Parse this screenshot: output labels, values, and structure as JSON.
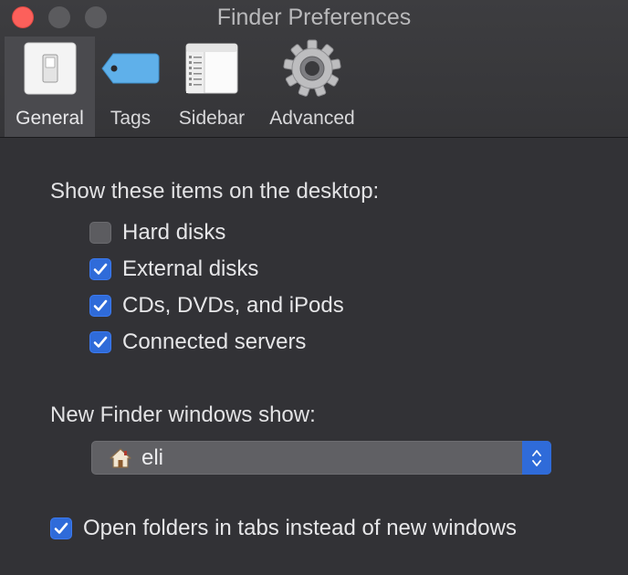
{
  "window": {
    "title": "Finder Preferences"
  },
  "toolbar": {
    "tabs": [
      {
        "label": "General",
        "icon": "switch-icon",
        "active": true
      },
      {
        "label": "Tags",
        "icon": "tag-icon",
        "active": false
      },
      {
        "label": "Sidebar",
        "icon": "sidebar-window-icon",
        "active": false
      },
      {
        "label": "Advanced",
        "icon": "gear-icon",
        "active": false
      }
    ]
  },
  "desktop_section": {
    "heading": "Show these items on the desktop:",
    "items": [
      {
        "label": "Hard disks",
        "checked": false
      },
      {
        "label": "External disks",
        "checked": true
      },
      {
        "label": "CDs, DVDs, and iPods",
        "checked": true
      },
      {
        "label": "Connected servers",
        "checked": true
      }
    ]
  },
  "new_windows": {
    "heading": "New Finder windows show:",
    "selected": "eli",
    "icon": "home-icon"
  },
  "open_in_tabs": {
    "label": "Open folders in tabs instead of new windows",
    "checked": true
  },
  "colors": {
    "accent": "#2f6bd9",
    "close": "#fc605b",
    "background": "#323236"
  }
}
